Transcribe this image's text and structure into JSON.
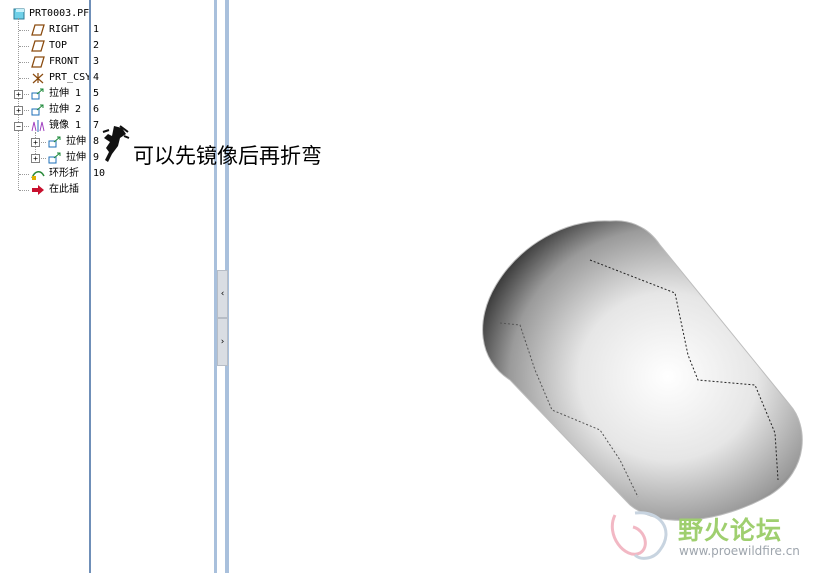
{
  "model_tree": {
    "root": {
      "label": "PRT0003.PF",
      "icon": "part-icon"
    },
    "items": [
      {
        "label": "RIGHT",
        "number": "1",
        "icon": "datum-plane-icon",
        "expander": ""
      },
      {
        "label": "TOP",
        "number": "2",
        "icon": "datum-plane-icon",
        "expander": ""
      },
      {
        "label": "FRONT",
        "number": "3",
        "icon": "datum-plane-icon",
        "expander": ""
      },
      {
        "label": "PRT_CSY",
        "number": "4",
        "icon": "coordinate-system-icon",
        "expander": ""
      },
      {
        "label": "拉伸 1",
        "number": "5",
        "icon": "extrude-icon",
        "expander": "+"
      },
      {
        "label": "拉伸 2",
        "number": "6",
        "icon": "extrude-icon",
        "expander": "+"
      },
      {
        "label": "镜像 1",
        "number": "7",
        "icon": "mirror-icon",
        "expander": "−"
      },
      {
        "label": "拉伸",
        "number": "8",
        "icon": "extrude-icon",
        "expander": "+"
      },
      {
        "label": "拉伸",
        "number": "9",
        "icon": "extrude-icon",
        "expander": "+"
      },
      {
        "label": "环形折",
        "number": "10",
        "icon": "toroidal-bend-icon",
        "expander": ""
      },
      {
        "label": "在此插",
        "number": "",
        "icon": "insert-here-arrow-icon",
        "expander": ""
      }
    ]
  },
  "splitter": {
    "collapse_glyph": "‹",
    "expand_glyph": "›"
  },
  "annotation": {
    "text": "可以先镜像后再折弯"
  },
  "watermark": {
    "title": "野火论坛",
    "url": "www.proewildfire.cn"
  },
  "colors": {
    "panel_border": "#6f8fb8",
    "splitter": "#a9c0dc",
    "watermark_green": "#9fcf6f"
  }
}
